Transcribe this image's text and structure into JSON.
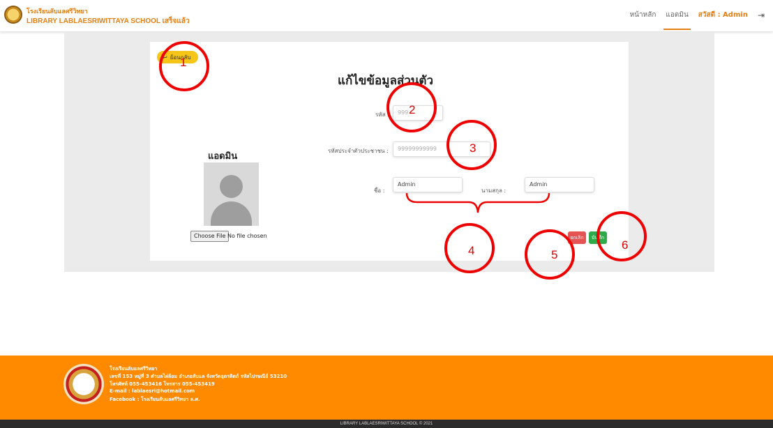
{
  "header": {
    "brand_thai": "โรงเรียนลับแลศรีวิทยา",
    "brand_en": "LIBRARY LABLAESRIWITTAYA SCHOOL เสร็จแล้ว",
    "nav": {
      "home": "หน้าหลัก",
      "admin": "แอดมิน",
      "greeting": "สวัสดี : Admin"
    },
    "logout_icon": "logout-icon"
  },
  "form": {
    "back_label": "ย้อนกลับ",
    "title": "แก้ไขข้อมูลส่วนตัว",
    "id_label": "รหัส :",
    "id_placeholder": "999",
    "citizen_label": "รหัสประจำตัวประชาชน :",
    "citizen_placeholder": "99999999999",
    "first_name_label": "ชื่อ :",
    "first_name_value": "Admin",
    "last_name_label": "นามสกุล :",
    "last_name_value": "Admin",
    "cancel_label": "ยกเลิก",
    "save_label": "บันทึก"
  },
  "profile": {
    "name": "แอดมิน",
    "choose_file": "Choose File",
    "no_file": "No file chosen"
  },
  "annotations": [
    "1",
    "2",
    "3",
    "4",
    "5",
    "6"
  ],
  "footer": {
    "school": "โรงเรียนลับแลศรีวิทยา",
    "address": "เลขที่ 153 หมู่ที่ 3 ตำบลไผ่ล้อม อำเภอลับแล จังหวัดอุตรดิตถ์ รหัสไปรษณีย์ 53210",
    "phone": "โทรศัพท์ 055-453416 โทรสาร 055-453419",
    "email": "E-mail : lablaesri@hotmail.com",
    "facebook": "Facebook : โรงเรียนลับแลศรีวิทยา ล.ศ.",
    "copyright": "LIBRARY LABLAESRIWITTAYA SCHOOL © 2021"
  },
  "colors": {
    "accent": "#e47f12",
    "footer": "#ff8a00",
    "cancel": "#e55353",
    "save": "#2eaa4a",
    "annotation": "#e00000"
  }
}
